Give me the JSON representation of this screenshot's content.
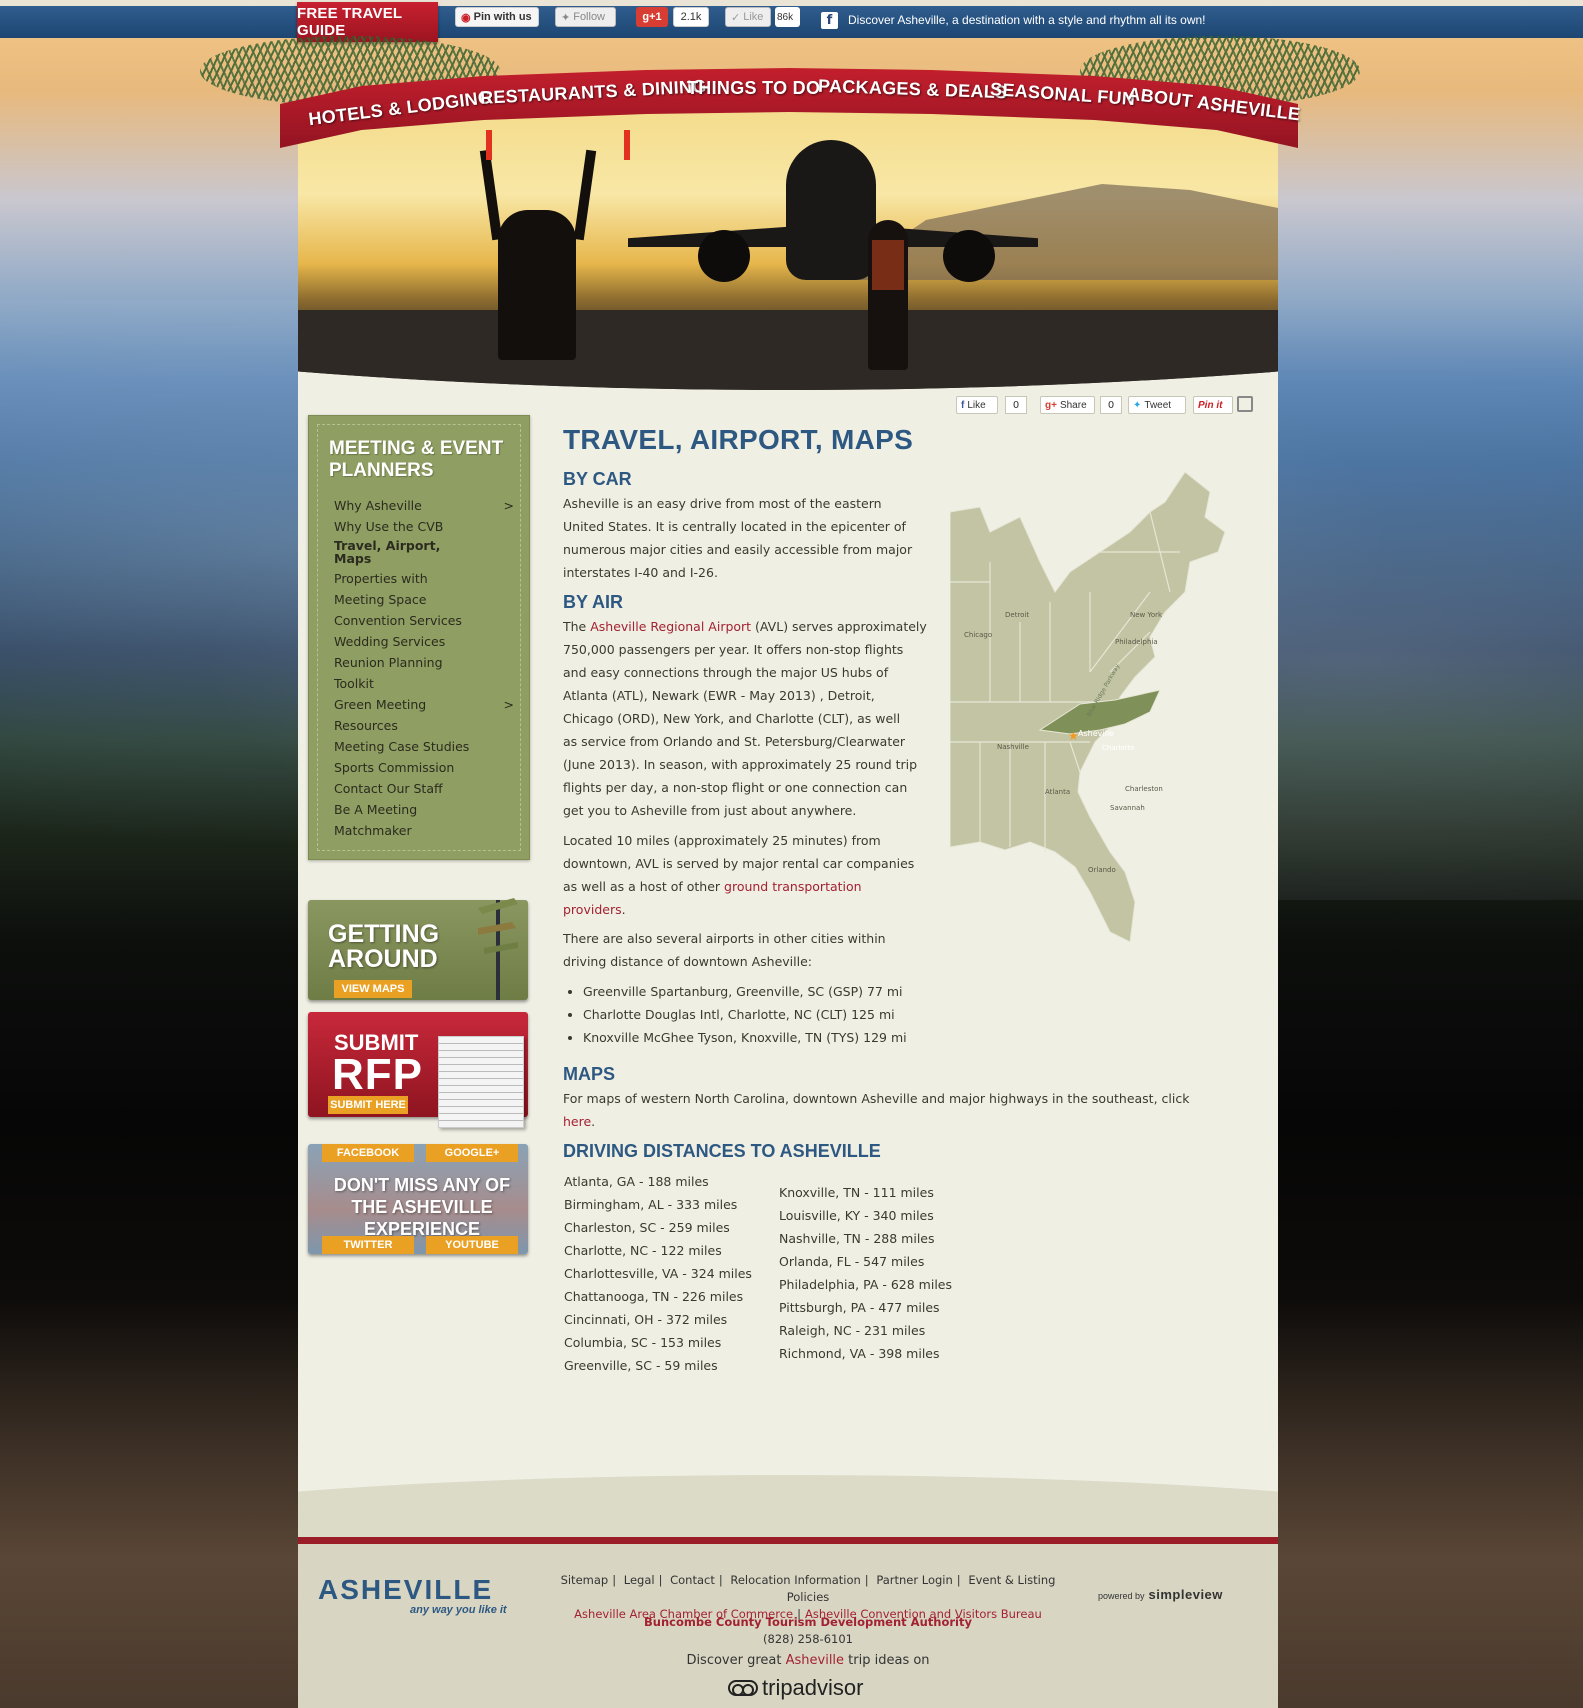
{
  "topbar": {
    "guide_label": "FREE TRAVEL GUIDE",
    "pin_label": "Pin with us",
    "follow_label": "Follow",
    "gplus_label": "g+1",
    "gplus_count": "2.1k",
    "like_label": "Like",
    "like_count": "86k",
    "fb_icon": "f",
    "tagline": "Discover Asheville, a destination with a style and rhythm all its own!"
  },
  "nav": {
    "items": [
      "HOTELS & LODGING",
      "RESTAURANTS & DINING",
      "THINGS TO DO",
      "PACKAGES & DEALS",
      "SEASONAL FUN",
      "ABOUT ASHEVILLE"
    ]
  },
  "share": {
    "fb_like": "Like",
    "fb_count": "0",
    "gplus_share": "Share",
    "gplus_count": "0",
    "tweet": "Tweet",
    "pinit": "Pin it"
  },
  "sidebar": {
    "title": "MEETING & EVENT PLANNERS",
    "items": [
      {
        "label": "Why Asheville",
        "arrow": ">"
      },
      {
        "label": "Why Use the CVB",
        "arrow": ""
      },
      {
        "label": "Travel, Airport, Maps",
        "arrow": "",
        "active": true
      },
      {
        "label": "Properties with Meeting Space",
        "arrow": ""
      },
      {
        "label": "Convention Services",
        "arrow": ""
      },
      {
        "label": "Wedding Services",
        "arrow": ""
      },
      {
        "label": "Reunion Planning Toolkit",
        "arrow": ""
      },
      {
        "label": "Green Meeting Resources",
        "arrow": ">"
      },
      {
        "label": "Meeting Case Studies",
        "arrow": ""
      },
      {
        "label": "Sports Commission",
        "arrow": ""
      },
      {
        "label": "Contact Our Staff",
        "arrow": ""
      },
      {
        "label": "Be A Meeting Matchmaker",
        "arrow": ""
      }
    ]
  },
  "promos": {
    "getting_around": {
      "line1": "GETTING",
      "line2": "AROUND",
      "button": "VIEW MAPS"
    },
    "rfp": {
      "line1": "SUBMIT",
      "line2": "RFP",
      "button": "SUBMIT HERE"
    },
    "social": {
      "facebook": "FACEBOOK",
      "google": "GOOGLE+",
      "message": "DON'T MISS ANY OF THE ASHEVILLE EXPERIENCE",
      "twitter": "TWITTER",
      "youtube": "YOUTUBE"
    }
  },
  "content": {
    "title": "TRAVEL, AIRPORT, MAPS",
    "by_car_heading": "BY CAR",
    "by_car_lines": [
      "Asheville is an easy drive from most of the eastern",
      "United States. It is centrally located in the epicenter of",
      "numerous major cities and easily accessible from major",
      "interstates I-40 and I-26."
    ],
    "by_air_heading": "BY AIR",
    "by_air_line1_pre": "The ",
    "by_air_line1_link": "Asheville Regional Airport",
    "by_air_line1_post": " (AVL) serves approximately",
    "by_air_lines": [
      "750,000 passengers per year. It offers non-stop flights",
      "and easy connections through the major US hubs of",
      "Atlanta (ATL), Newark (EWR - May 2013) , Detroit,",
      "Chicago (ORD), New York, and Charlotte (CLT), as well",
      "as service from Orlando and St. Petersburg/Clearwater",
      "(June 2013). In season, with approximately 25 round trip",
      "flights per day, a non-stop flight or one connection can",
      "get you to Asheville from just about anywhere."
    ],
    "located_lines": [
      "Located 10 miles (approximately 25 minutes) from",
      "downtown, AVL is served by major rental car companies"
    ],
    "located_line3_pre": "as well as a host of other ",
    "located_link1": "ground transportation",
    "located_link2": "providers",
    "located_end": ".",
    "other_airports_lines": [
      "There are also several airports in other cities within",
      "driving distance of downtown Asheville:"
    ],
    "airports": [
      "Greenville Spartanburg, Greenville, SC (GSP) 77 mi",
      "Charlotte Douglas Intl, Charlotte, NC (CLT) 125 mi",
      "Knoxville McGhee Tyson, Knoxville, TN (TYS) 129 mi"
    ],
    "maps_heading": "MAPS",
    "maps_line1": "For maps of western North Carolina, downtown Asheville and major highways in the southeast, click",
    "maps_link": "here",
    "maps_end": ".",
    "driving_heading": "DRIVING DISTANCES TO ASHEVILLE",
    "distances_left": [
      "Atlanta, GA - 188 miles",
      "Birmingham, AL - 333 miles",
      "Charleston, SC - 259 miles",
      "Charlotte, NC - 122 miles",
      "Charlottesville, VA - 324 miles",
      "Chattanooga, TN - 226 miles",
      "Cincinnati, OH - 372 miles",
      "Columbia, SC - 153 miles",
      "Greenville, SC - 59 miles"
    ],
    "distances_right": [
      "Knoxville, TN - 111 miles",
      "Louisville, KY - 340 miles",
      "Nashville, TN - 288 miles",
      "Orlanda, FL - 547 miles",
      "Philadelphia, PA - 628 miles",
      "Pittsburgh, PA - 477 miles",
      "Raleigh, NC - 231 miles",
      "Richmond, VA - 398 miles"
    ]
  },
  "map_labels": {
    "detroit": "Detroit",
    "chicago": "Chicago",
    "newyork": "New York",
    "philadelphia": "Philadelphia",
    "nashville": "Nashville",
    "asheville": "Asheville",
    "charlotte": "Charlotte",
    "atlanta": "Atlanta",
    "charleston": "Charleston",
    "savannah": "Savannah",
    "orlando": "Orlando",
    "parkway": "Blue Ridge Parkway"
  },
  "footer": {
    "logo": "ASHEVILLE",
    "logo_tag": "any way you like it",
    "links": [
      "Sitemap",
      "Legal",
      "Contact",
      "Relocation Information",
      "Partner Login",
      "Event & Listing Policies"
    ],
    "chamber_link": "Asheville Area Chamber of Commerce",
    "cvb_link": "Asheville Convention and Visitors Bureau",
    "authority": "Buncombe County Tourism Development Authority",
    "phone": "(828) 258-6101",
    "discover_pre": "Discover great ",
    "discover_link": "Asheville",
    "discover_post": " trip ideas on",
    "tripadvisor": "tripadvisor",
    "powered_by": "powered by",
    "simpleview": "simpleview"
  },
  "colors": {
    "brand_red": "#a32232",
    "heading_blue": "#2d5882",
    "sidebar_green": "#8f9e62",
    "accent_orange": "#e9a023",
    "topbar_blue": "#1d4672"
  }
}
